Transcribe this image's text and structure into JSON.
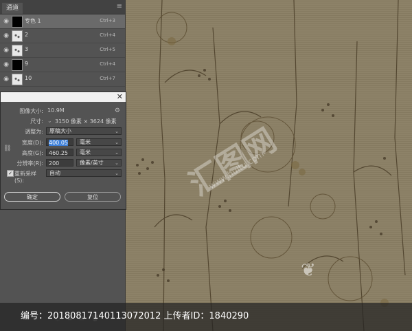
{
  "channels_panel": {
    "tab_label": "通道",
    "menu_icon": "hamburger-icon",
    "rows": [
      {
        "name": "专色 1",
        "shortcut": "Ctrl+3",
        "selected": true,
        "thumb": "black"
      },
      {
        "name": "2",
        "shortcut": "Ctrl+4",
        "selected": false,
        "thumb": "light"
      },
      {
        "name": "3",
        "shortcut": "Ctrl+5",
        "selected": false,
        "thumb": "light"
      },
      {
        "name": "9",
        "shortcut": "Ctrl+4",
        "selected": false,
        "thumb": "black"
      },
      {
        "name": "10",
        "shortcut": "Ctrl+7",
        "selected": false,
        "thumb": "light"
      }
    ]
  },
  "image_size_dialog": {
    "image_size_label": "图像大小:",
    "image_size_value": "10.9M",
    "dimensions_label": "尺寸:",
    "dimensions_value": "3150 像素 × 3624 像素",
    "fit_to_label": "调整为:",
    "fit_to_value": "原稿大小",
    "width_label": "宽度(D):",
    "width_value": "400.05",
    "width_unit": "毫米",
    "height_label": "高度(G):",
    "height_value": "460.25",
    "height_unit": "毫米",
    "resolution_label": "分辨率(R):",
    "resolution_value": "200",
    "resolution_unit": "像素/英寸",
    "resample_label": "重新采样(S):",
    "resample_value": "自动",
    "resample_checked": true,
    "ok_label": "确定",
    "reset_label": "复位"
  },
  "footer": {
    "text": "编号：20180817140113072012 上传者ID：1840290"
  },
  "watermark": {
    "text": "汇图网",
    "url": "www.huitu.com"
  }
}
